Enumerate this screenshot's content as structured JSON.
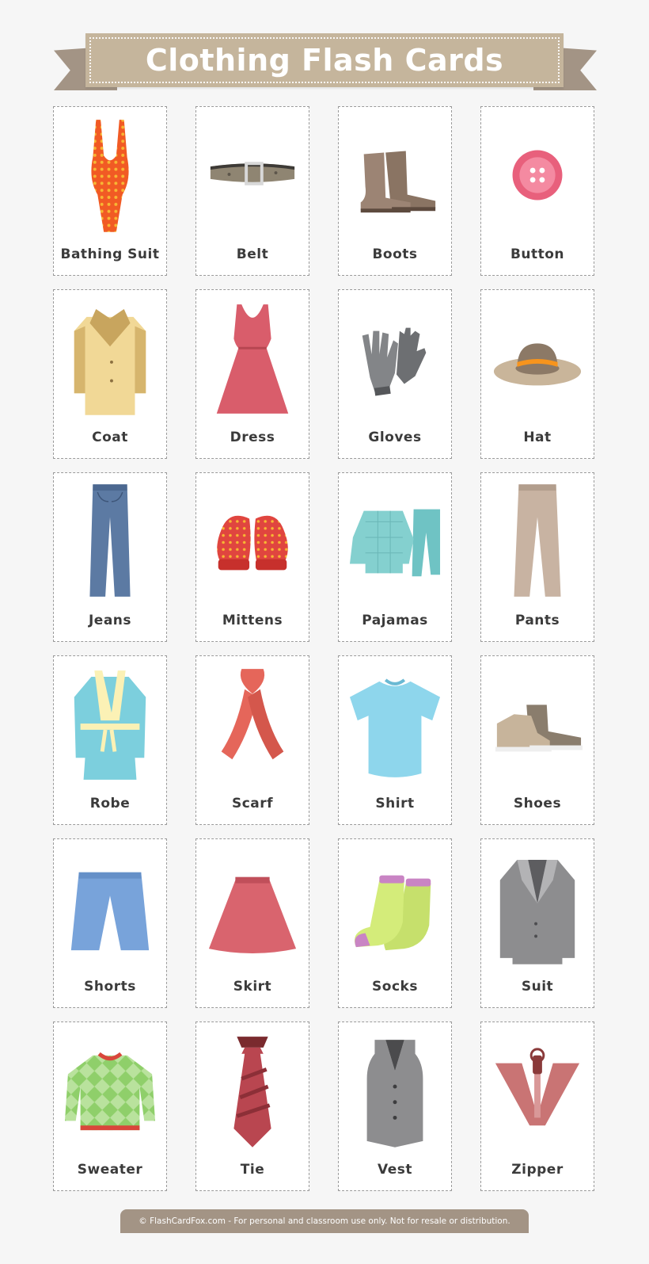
{
  "header": {
    "title": "Clothing Flash Cards"
  },
  "cards": [
    {
      "label": "Bathing Suit",
      "icon": "bathing-suit-icon"
    },
    {
      "label": "Belt",
      "icon": "belt-icon"
    },
    {
      "label": "Boots",
      "icon": "boots-icon"
    },
    {
      "label": "Button",
      "icon": "button-icon"
    },
    {
      "label": "Coat",
      "icon": "coat-icon"
    },
    {
      "label": "Dress",
      "icon": "dress-icon"
    },
    {
      "label": "Gloves",
      "icon": "gloves-icon"
    },
    {
      "label": "Hat",
      "icon": "hat-icon"
    },
    {
      "label": "Jeans",
      "icon": "jeans-icon"
    },
    {
      "label": "Mittens",
      "icon": "mittens-icon"
    },
    {
      "label": "Pajamas",
      "icon": "pajamas-icon"
    },
    {
      "label": "Pants",
      "icon": "pants-icon"
    },
    {
      "label": "Robe",
      "icon": "robe-icon"
    },
    {
      "label": "Scarf",
      "icon": "scarf-icon"
    },
    {
      "label": "Shirt",
      "icon": "shirt-icon"
    },
    {
      "label": "Shoes",
      "icon": "shoes-icon"
    },
    {
      "label": "Shorts",
      "icon": "shorts-icon"
    },
    {
      "label": "Skirt",
      "icon": "skirt-icon"
    },
    {
      "label": "Socks",
      "icon": "socks-icon"
    },
    {
      "label": "Suit",
      "icon": "suit-icon"
    },
    {
      "label": "Sweater",
      "icon": "sweater-icon"
    },
    {
      "label": "Tie",
      "icon": "tie-icon"
    },
    {
      "label": "Vest",
      "icon": "vest-icon"
    },
    {
      "label": "Zipper",
      "icon": "zipper-icon"
    }
  ],
  "footer": {
    "text": "© FlashCardFox.com - For personal and classroom use only. Not for resale or distribution."
  },
  "colors": {
    "page_background": "#f6f6f6",
    "banner": "#c5b59c",
    "ribbon_tail": "#a39485",
    "footer": "#a39485",
    "label_text": "#3b3b3b"
  }
}
